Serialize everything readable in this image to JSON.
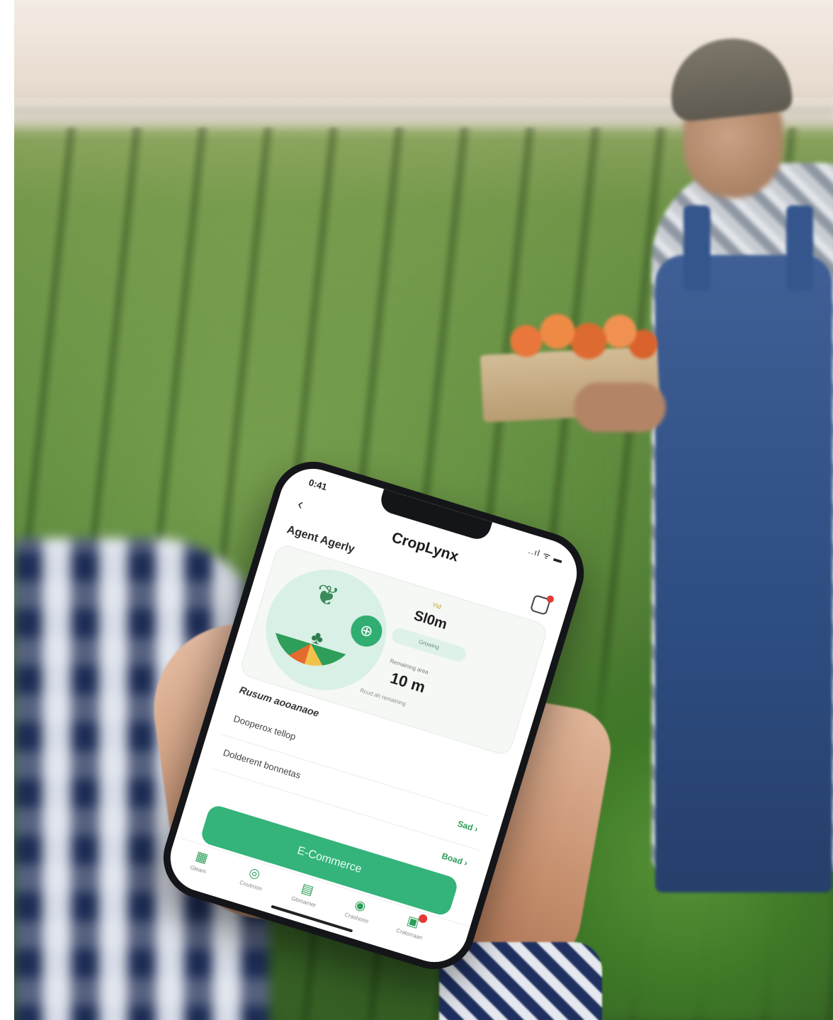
{
  "status_bar": {
    "time": "0:41",
    "icons": "..ıl ᯤ ▬"
  },
  "header": {
    "back_icon": "‹",
    "title": "CropLynx",
    "notification_icon": "bell-icon"
  },
  "section": {
    "title": "Agent Agerly"
  },
  "summary_card": {
    "icons": [
      "sprout-icon",
      "plant-icon",
      "hub-icon"
    ],
    "kpi_1_tag": "Yid",
    "kpi_1_value": "Sl0m",
    "kpi_1_pill": "Growing",
    "kpi_2_label": "Remaining area",
    "kpi_2_value": "10 m",
    "kpi_2_note": "Rcud ah remaining"
  },
  "list": {
    "title": "Rusum aooanaoe",
    "rows": [
      {
        "label": "Dooperox tellop",
        "value": ""
      },
      {
        "label": "Dolderent bonnetas",
        "value": "Sad ›"
      },
      {
        "label": "",
        "value": "Boad ›"
      }
    ]
  },
  "cta": {
    "label": "E-Commerce"
  },
  "tabs": [
    {
      "icon": "grid-icon",
      "label": "Gleam"
    },
    {
      "icon": "globe-icon",
      "label": "Coutroon"
    },
    {
      "icon": "calendar-icon",
      "label": "Gbroamer"
    },
    {
      "icon": "camera-icon",
      "label": "Crashoon"
    },
    {
      "icon": "wallet-icon",
      "label": "Cratorraan"
    }
  ],
  "colors": {
    "brand_green": "#34b37a",
    "badge_red": "#e53935"
  }
}
